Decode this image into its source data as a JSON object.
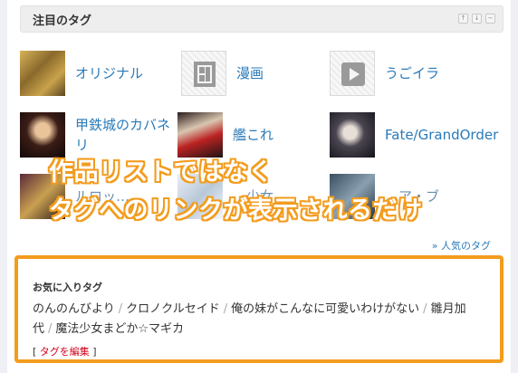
{
  "header": {
    "title": "注目のタグ",
    "buttons": [
      "↑",
      "↓",
      "−"
    ]
  },
  "tags": [
    {
      "label": "オリジナル",
      "thumb": "original-thumb"
    },
    {
      "label": "漫画",
      "thumb": "manga-icon"
    },
    {
      "label": "うごイラ",
      "thumb": "play-icon"
    },
    {
      "label": "甲鉄城のカバネリ",
      "thumb": "kabaneri-thumb"
    },
    {
      "label": "艦これ",
      "thumb": "kancolle-thumb"
    },
    {
      "label": "Fate/GrandOrder",
      "thumb": "fgo-thumb"
    },
    {
      "label": "ルロッ…",
      "thumb": "partial-thumb"
    },
    {
      "label": "…少女",
      "thumb": "partial-thumb"
    },
    {
      "label": "…ア・ブ",
      "thumb": "partial-thumb"
    }
  ],
  "overlay": {
    "line1": "作品リストではなく",
    "line2": "タグへのリンクが表示されるだけ",
    "outline_color": "#f39c1e"
  },
  "popular_link": "» 人気のタグ",
  "favorites": {
    "title": "お気に入りタグ",
    "items": [
      "のんのんびより",
      "クロノクルセイド",
      "俺の妹がこんなに可愛いわけがない",
      "雛月加代",
      "魔法少女まどか☆マギカ"
    ],
    "separator": "/",
    "edit_prefix": "[ ",
    "edit_label": "タグを編集",
    "edit_suffix": " ]"
  },
  "colors": {
    "link": "#2a7ab8",
    "highlight": "#f39c1e",
    "edit": "#d0021b"
  }
}
